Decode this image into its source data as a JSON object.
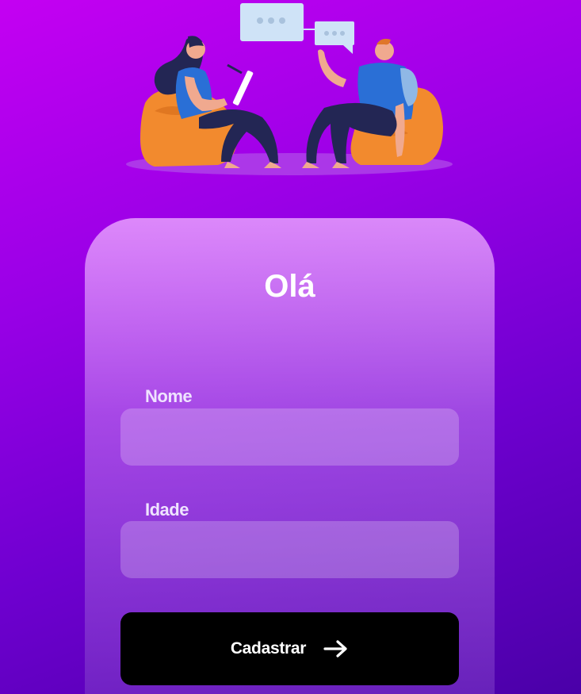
{
  "hero": {
    "illustration": "two-people-chatting-on-beanbags"
  },
  "form": {
    "title": "Olá",
    "fields": [
      {
        "label": "Nome",
        "value": "",
        "placeholder": ""
      },
      {
        "label": "Idade",
        "value": "",
        "placeholder": ""
      }
    ],
    "submit": {
      "label": "Cadastrar",
      "icon": "arrow-right-icon"
    }
  },
  "colors": {
    "background_top": "#c400f2",
    "background_bottom": "#4a00a8",
    "button": "#000000",
    "text": "#ffffff"
  }
}
